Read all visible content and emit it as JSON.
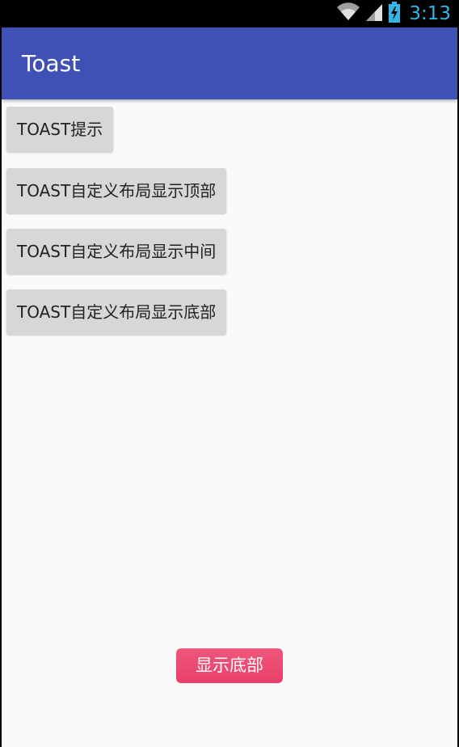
{
  "status_bar": {
    "time": "3:13",
    "icons": [
      "wifi-icon",
      "signal-icon",
      "battery-charging-icon"
    ],
    "time_color": "#33b5e5"
  },
  "app_bar": {
    "title": "Toast",
    "color": "#3f51b5"
  },
  "buttons": [
    {
      "label": "TOAST提示"
    },
    {
      "label": "TOAST自定义布局显示顶部"
    },
    {
      "label": "TOAST自定义布局显示中间"
    },
    {
      "label": "TOAST自定义布局显示底部"
    }
  ],
  "toast": {
    "text": "显示底部",
    "color": "#ec4a71"
  }
}
